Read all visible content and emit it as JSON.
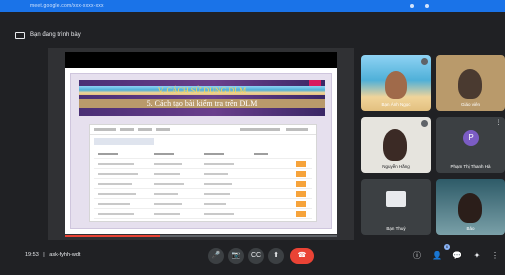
{
  "browser": {
    "url": "meet.google.com/xxx-xxxx-xxx"
  },
  "presenting": {
    "label": "Bạn đang trình bày"
  },
  "slide": {
    "title_line1": "V. CÁCH SỬ DỤNG DLM",
    "title_line2": "5. Cách tạo bài kiểm tra trên DLM"
  },
  "presentation_progress": 0.35,
  "participants": [
    {
      "name": "Bạn Ánh Ngọc",
      "tile": "photo-beach"
    },
    {
      "name": "Giáo viên",
      "tile": "camera"
    },
    {
      "name": "Nguyễn Hằng",
      "tile": "camera"
    },
    {
      "name": "Phạm Thị Thanh Hà",
      "tile": "avatar",
      "initial": "P"
    },
    {
      "name": "Bạn Thuỷ",
      "tile": "logo"
    },
    {
      "name": "Bảo",
      "tile": "camera"
    }
  ],
  "bottom": {
    "time": "19:53",
    "meeting_code": "ask-fyhh-wdt",
    "participant_count": "6"
  },
  "controls": {
    "mic": "🎤",
    "camera": "📷",
    "captions": "CC",
    "present": "⬆",
    "end": "☎",
    "info": "ⓘ",
    "people": "👤",
    "chat": "💬",
    "activities": "✦",
    "menu": "⋮"
  },
  "colors": {
    "accent": "#1a73e8",
    "end_call": "#ea4335",
    "background": "#202124"
  }
}
